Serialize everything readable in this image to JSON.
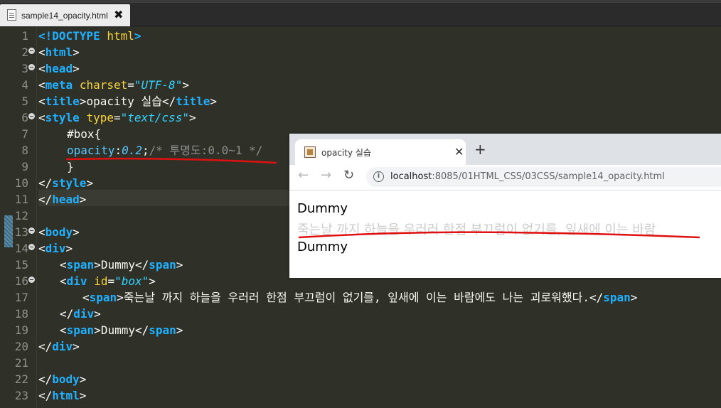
{
  "editor": {
    "tab_filename": "sample14_opacity.html",
    "tab_close": "✖",
    "line_numbers": [
      "1",
      "2",
      "3",
      "4",
      "5",
      "6",
      "7",
      "8",
      "9",
      "10",
      "11",
      "12",
      "13",
      "14",
      "15",
      "16",
      "17",
      "18",
      "19",
      "20",
      "21",
      "22",
      "23"
    ],
    "code": {
      "l1_doctype": "<!DOCTYPE",
      "l1_html": " html",
      "l1_end": ">",
      "l4_attr": "charset",
      "l4_val": "\"UTF-8\"",
      "l5_text": "opacity 실습",
      "l6_attr": "type",
      "l6_val": "\"text/css\"",
      "l7_selector": "#box{",
      "l8_prop": "opacity",
      "l8_value": "0.2",
      "l8_semi": ";",
      "l8_comment": "/* 투명도:0.0~1 */",
      "l9_brace": "}",
      "l15_text": "Dummy",
      "l16_attr": "id",
      "l16_val": "\"box\"",
      "l17_text": "죽는날 까지 하늘을 우러러 한점 부끄럼이 없기를, 잎새에 이는 바람에도 나는 괴로워했다.",
      "l19_text": "Dummy"
    }
  },
  "browser": {
    "tab_title": "opacity 실습",
    "tab_close": "✕",
    "new_tab": "+",
    "back": "←",
    "forward": "→",
    "reload": "↻",
    "info": "i",
    "url_host": "localhost",
    "url_path": ":8085/01HTML_CSS/03CSS/sample14_opacity.html",
    "content_dummy_1": "Dummy",
    "content_faded": "죽는날 까지 하늘을 우러러 한점 부끄럼이 없기를, 잎새에 이는 바람",
    "content_dummy_2": "Dummy",
    "faded_opacity": 0.2
  },
  "annotation_color": "#e01010"
}
